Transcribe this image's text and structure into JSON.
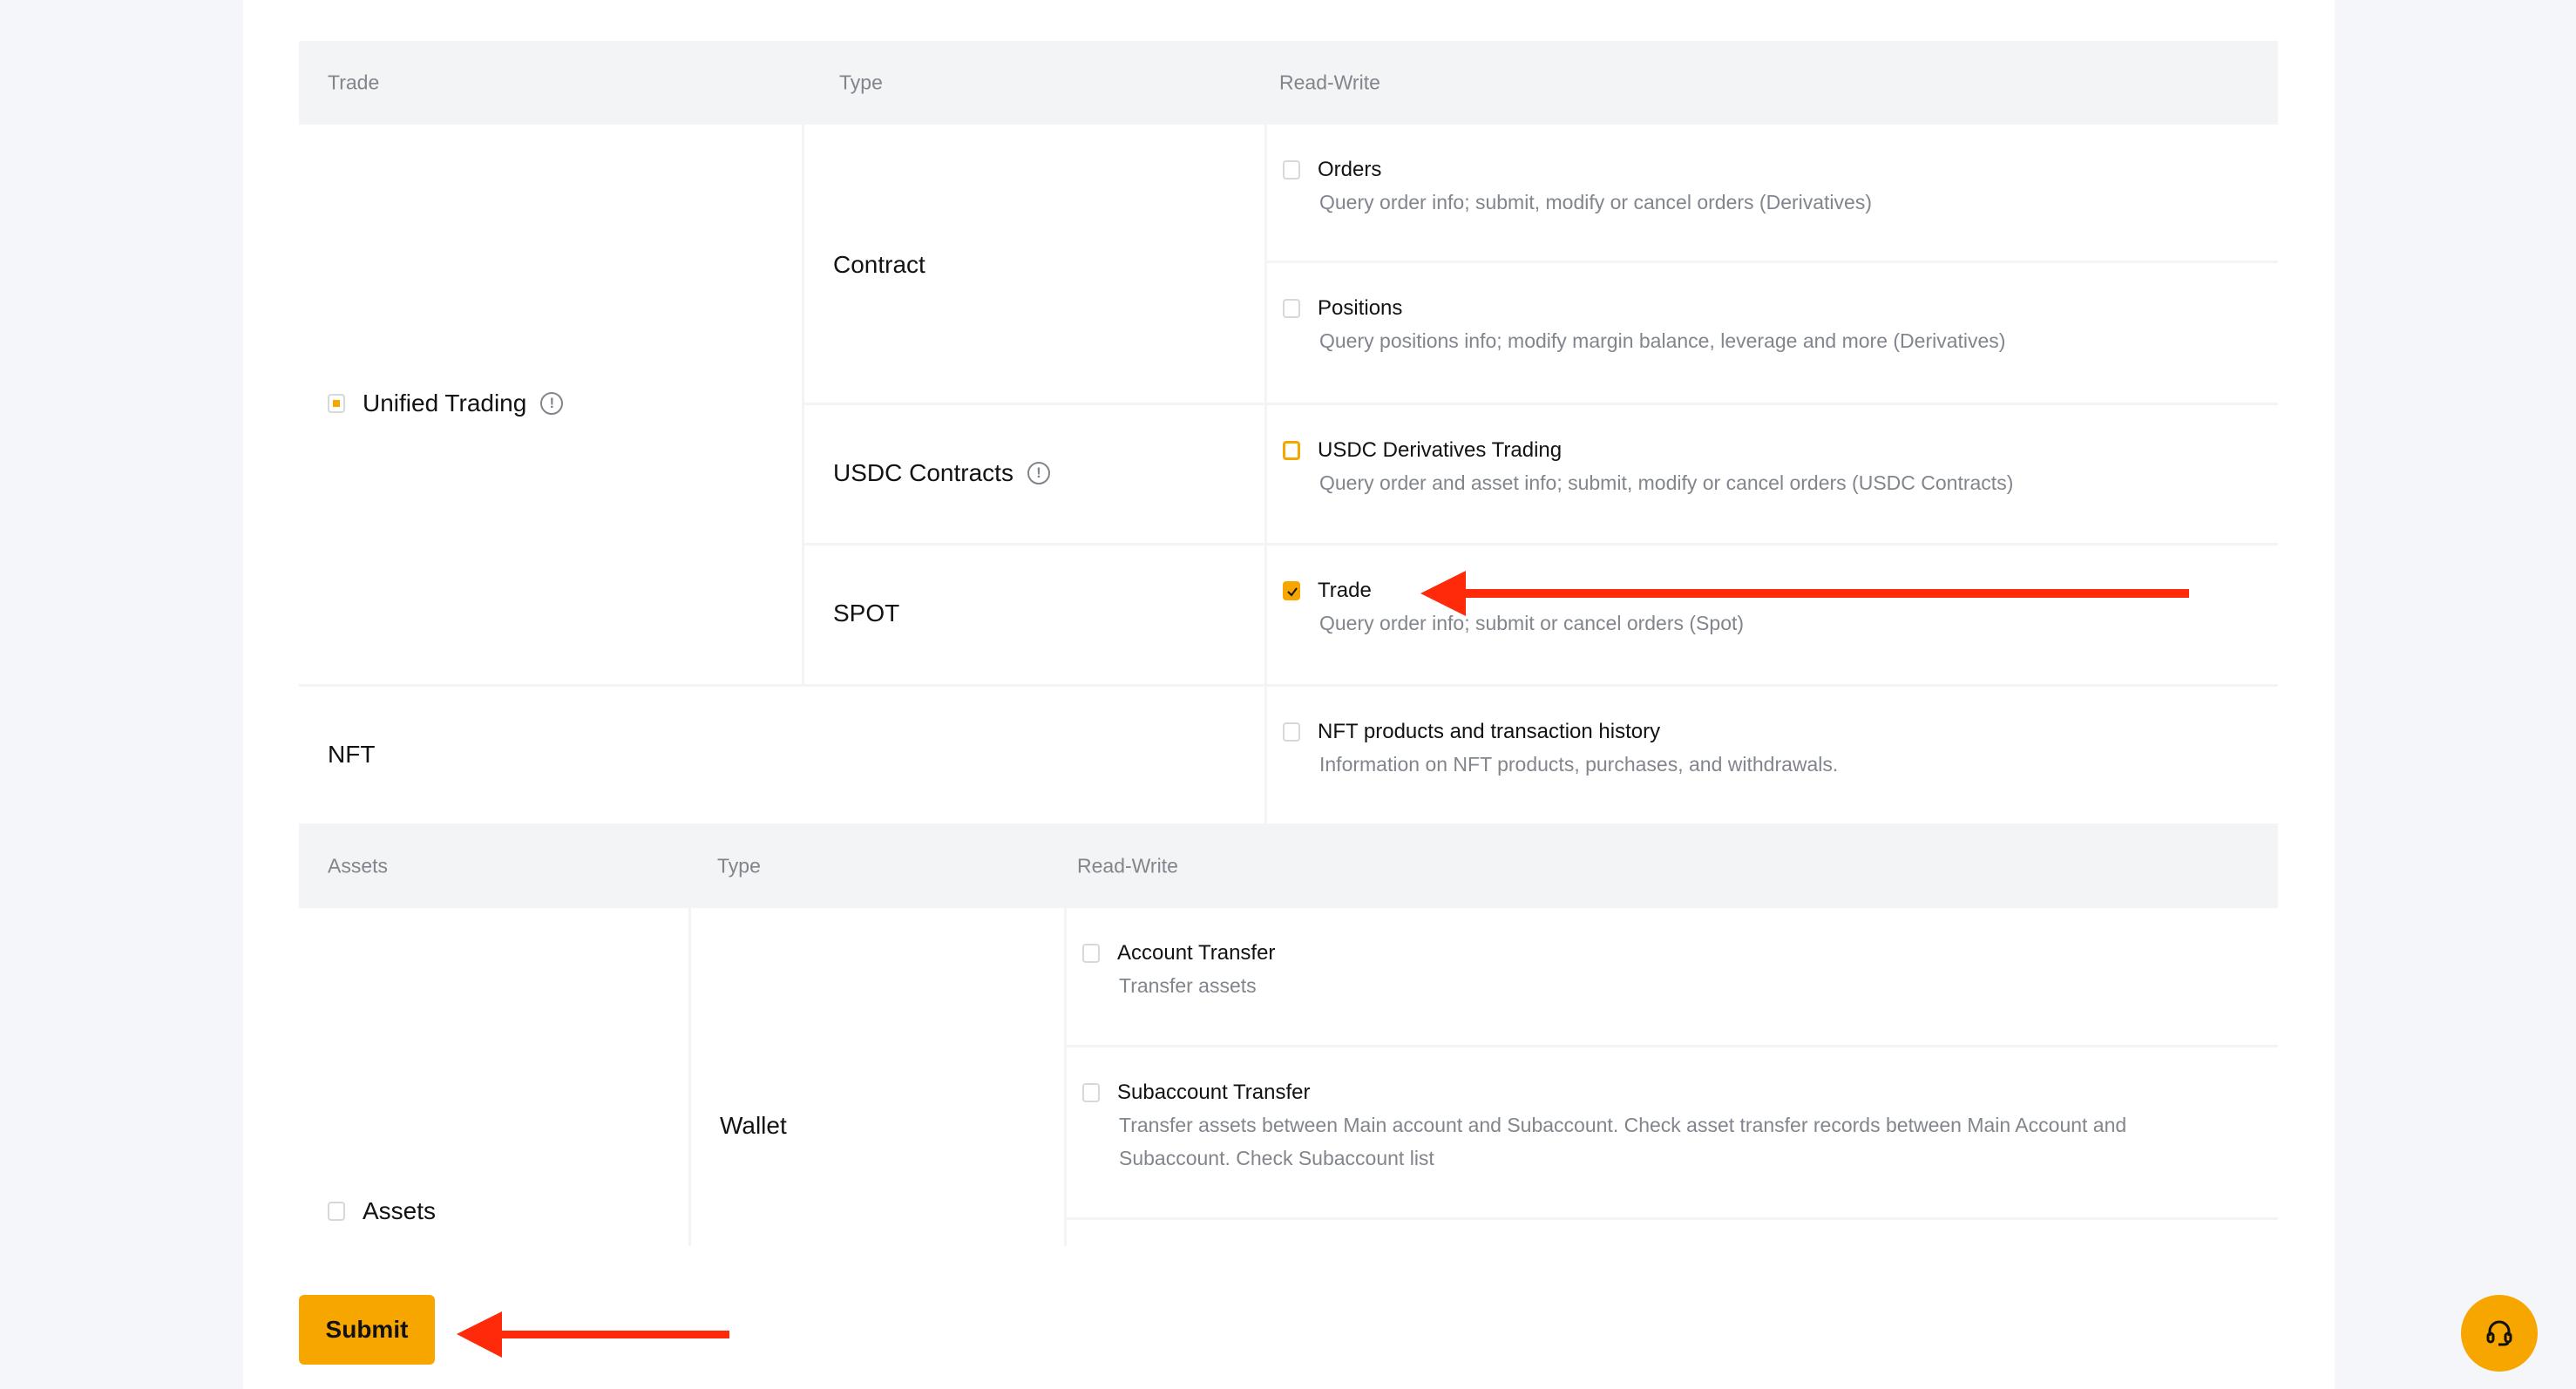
{
  "trade_table": {
    "headers": [
      "Trade",
      "Type",
      "Read-Write"
    ],
    "category": {
      "label": "Unified Trading",
      "state": "indeterminate",
      "info_icon": "info-icon"
    },
    "types": [
      {
        "label": "Contract",
        "info_icon": null
      },
      {
        "label": "USDC Contracts",
        "info_icon": "info-icon"
      },
      {
        "label": "SPOT",
        "info_icon": null
      }
    ],
    "permissions": [
      {
        "title": "Orders",
        "description": "Query order info; submit, modify or cancel orders (Derivatives)",
        "checked": false
      },
      {
        "title": "Positions",
        "description": "Query positions info; modify margin balance, leverage and more (Derivatives)",
        "checked": false
      },
      {
        "title": "USDC Derivatives Trading",
        "description": "Query order and asset info; submit, modify or cancel orders (USDC Contracts)",
        "checked": false,
        "focused": true
      },
      {
        "title": "Trade",
        "description": "Query order info; submit or cancel orders (Spot)",
        "checked": true
      }
    ],
    "nft": {
      "label": "NFT",
      "permission": {
        "title": "NFT products and transaction history",
        "description": "Information on NFT products, purchases, and withdrawals.",
        "checked": false
      }
    }
  },
  "assets_table": {
    "headers": [
      "Assets",
      "Type",
      "Read-Write"
    ],
    "category": {
      "label": "Assets",
      "checked": false
    },
    "type": "Wallet",
    "permissions": [
      {
        "title": "Account Transfer",
        "description": "Transfer assets",
        "checked": false
      },
      {
        "title": "Subaccount Transfer",
        "description": "Transfer assets between Main account and Subaccount. Check asset transfer records between Main Account and Subaccount. Check Subaccount list",
        "checked": false
      }
    ]
  },
  "actions": {
    "submit_label": "Submit"
  },
  "support": {
    "icon": "headset-icon"
  },
  "colors": {
    "accent": "#f7a600",
    "annotation_arrow": "#ff2a0a",
    "header_bg": "#f3f4f6",
    "muted_text": "#81858c"
  }
}
